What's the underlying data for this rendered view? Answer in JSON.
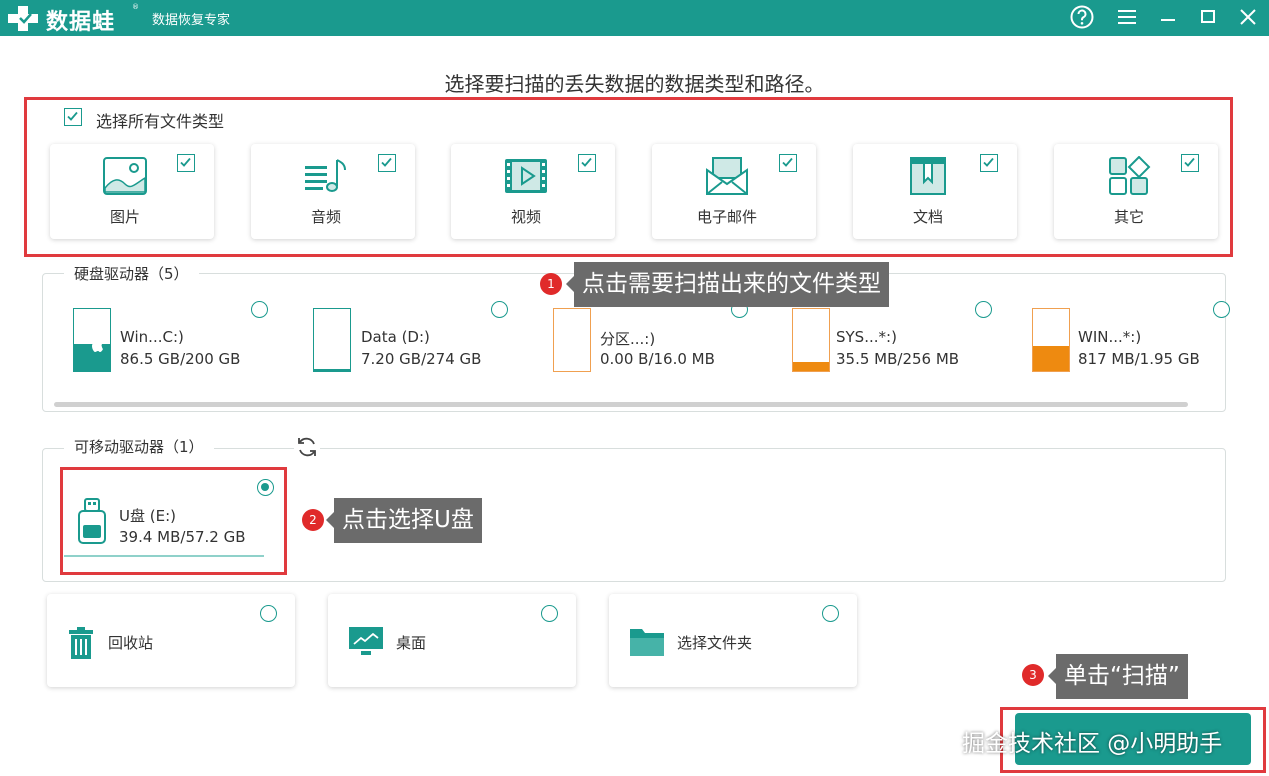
{
  "titlebar": {
    "logo_text": "数据蛙",
    "logo_reg": "®",
    "subtitle": "数据恢复专家",
    "buttons": [
      "help-icon",
      "menu-icon",
      "minimize-icon",
      "maximize-icon",
      "close-icon"
    ]
  },
  "heading": "选择要扫描的丢失数据的数据类型和路径。",
  "file_types": {
    "select_all_label": "选择所有文件类型",
    "select_all_checked": true,
    "items": [
      {
        "label": "图片",
        "icon": "image-icon",
        "checked": true
      },
      {
        "label": "音频",
        "icon": "audio-icon",
        "checked": true
      },
      {
        "label": "视频",
        "icon": "video-icon",
        "checked": true
      },
      {
        "label": "电子邮件",
        "icon": "email-icon",
        "checked": true
      },
      {
        "label": "文档",
        "icon": "document-icon",
        "checked": true
      },
      {
        "label": "其它",
        "icon": "other-icon",
        "checked": true
      }
    ]
  },
  "hard_drives": {
    "title": "硬盘驱动器（5）",
    "items": [
      {
        "name": "Win...C:)",
        "size": "86.5 GB/200 GB",
        "used_fraction": 0.43,
        "color": "#1a9a8e",
        "selected": false
      },
      {
        "name": "Data (D:)",
        "size": "7.20 GB/274 GB",
        "used_fraction": 0.03,
        "color": "#1a9a8e",
        "selected": false
      },
      {
        "name": "分区...:)",
        "size": "0.00  B/16.0 MB",
        "used_fraction": 0.0,
        "color": "#ee8a10",
        "selected": false
      },
      {
        "name": "SYS...*:)",
        "size": "35.5 MB/256 MB",
        "used_fraction": 0.14,
        "color": "#ee8a10",
        "selected": false
      },
      {
        "name": "WIN...*:)",
        "size": "817 MB/1.95 GB",
        "used_fraction": 0.41,
        "color": "#ee8a10",
        "selected": false
      }
    ]
  },
  "removable_drives": {
    "title": "可移动驱动器（1）",
    "items": [
      {
        "name": "U盘 (E:)",
        "size": "39.4 MB/57.2 GB",
        "selected": true
      }
    ]
  },
  "locations": [
    {
      "label": "回收站",
      "icon": "recycle-bin-icon"
    },
    {
      "label": "桌面",
      "icon": "desktop-icon"
    },
    {
      "label": "选择文件夹",
      "icon": "folder-icon"
    }
  ],
  "callouts": [
    {
      "num": "1",
      "text": "点击需要扫描出来的文件类型"
    },
    {
      "num": "2",
      "text": "点击选择U盘"
    },
    {
      "num": "3",
      "text": "单击“扫描”"
    }
  ],
  "watermark": "掘金技术社区 @小明助手",
  "colors": {
    "accent": "#1a9a8e",
    "annotation": "#e03a3e",
    "warning": "#ee8a10"
  }
}
